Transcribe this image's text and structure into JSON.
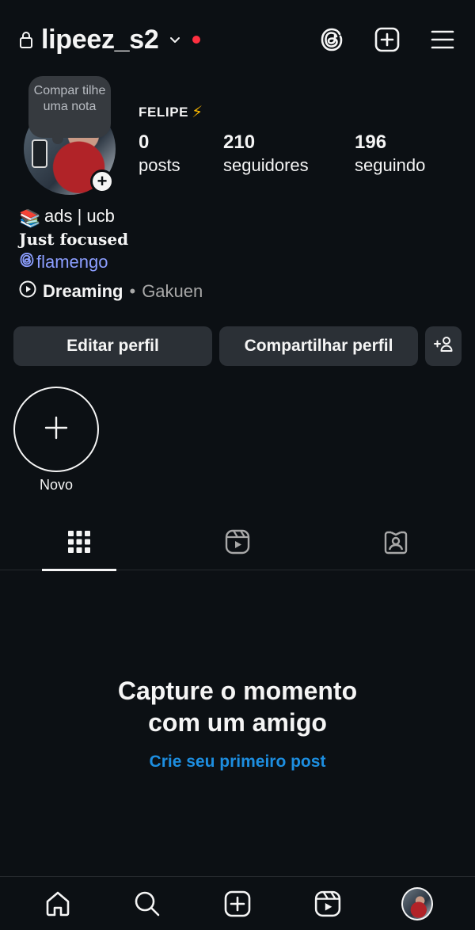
{
  "header": {
    "username": "lipeez_s2",
    "icons": [
      "lock-icon",
      "chevron-down-icon",
      "threads-icon",
      "new-post-icon",
      "menu-icon"
    ],
    "notification_dot_color": "#ff3040"
  },
  "profile": {
    "note_text": "Compar tilhe uma nota",
    "display_name": "FELIPE",
    "display_emoji": "⚡",
    "stats": [
      {
        "value": "0",
        "label": "posts"
      },
      {
        "value": "210",
        "label": "seguidores"
      },
      {
        "value": "196",
        "label": "seguindo"
      }
    ],
    "bio_line1_emoji": "📚",
    "bio_line1": "ads | ucb",
    "bio_line2": "Just focused",
    "threads_link": "flamengo",
    "music_title": "Dreaming",
    "music_separator": "•",
    "music_artist": "Gakuen"
  },
  "buttons": {
    "edit": "Editar perfil",
    "share": "Compartilhar perfil"
  },
  "highlights": {
    "new_label": "Novo"
  },
  "tabs": [
    "grid-icon",
    "reels-icon",
    "tagged-icon"
  ],
  "empty_state": {
    "headline_line1": "Capture o momento",
    "headline_line2": "com um amigo",
    "cta": "Crie seu primeiro post",
    "cta_color": "#1d8ee0"
  },
  "bottom_nav": [
    "home-icon",
    "search-icon",
    "create-icon",
    "reels-icon",
    "profile-avatar"
  ]
}
